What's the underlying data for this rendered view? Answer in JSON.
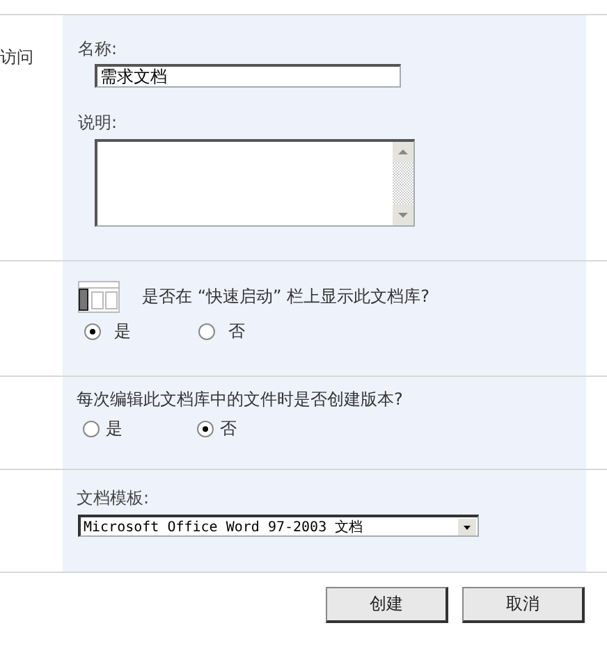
{
  "sections": [
    {
      "kind": "text",
      "side_label": "访问",
      "name_label": "名称:",
      "name_value": "需求文档",
      "description_label": "说明:"
    },
    {
      "kind": "quicklaunch",
      "question": "是否在 “快速启动” 栏上显示此文档库?",
      "options": [
        {
          "label": "是",
          "selected": true
        },
        {
          "label": "否",
          "selected": false
        }
      ]
    },
    {
      "kind": "versioning",
      "question": "每次编辑此文档库中的文件时是否创建版本?",
      "options": [
        {
          "label": "是",
          "selected": false
        },
        {
          "label": "否",
          "selected": true
        }
      ]
    },
    {
      "kind": "template",
      "label": "文档模板:",
      "value": "Microsoft Office Word 97-2003 文档"
    }
  ],
  "buttons": [
    "创建",
    "取消"
  ]
}
